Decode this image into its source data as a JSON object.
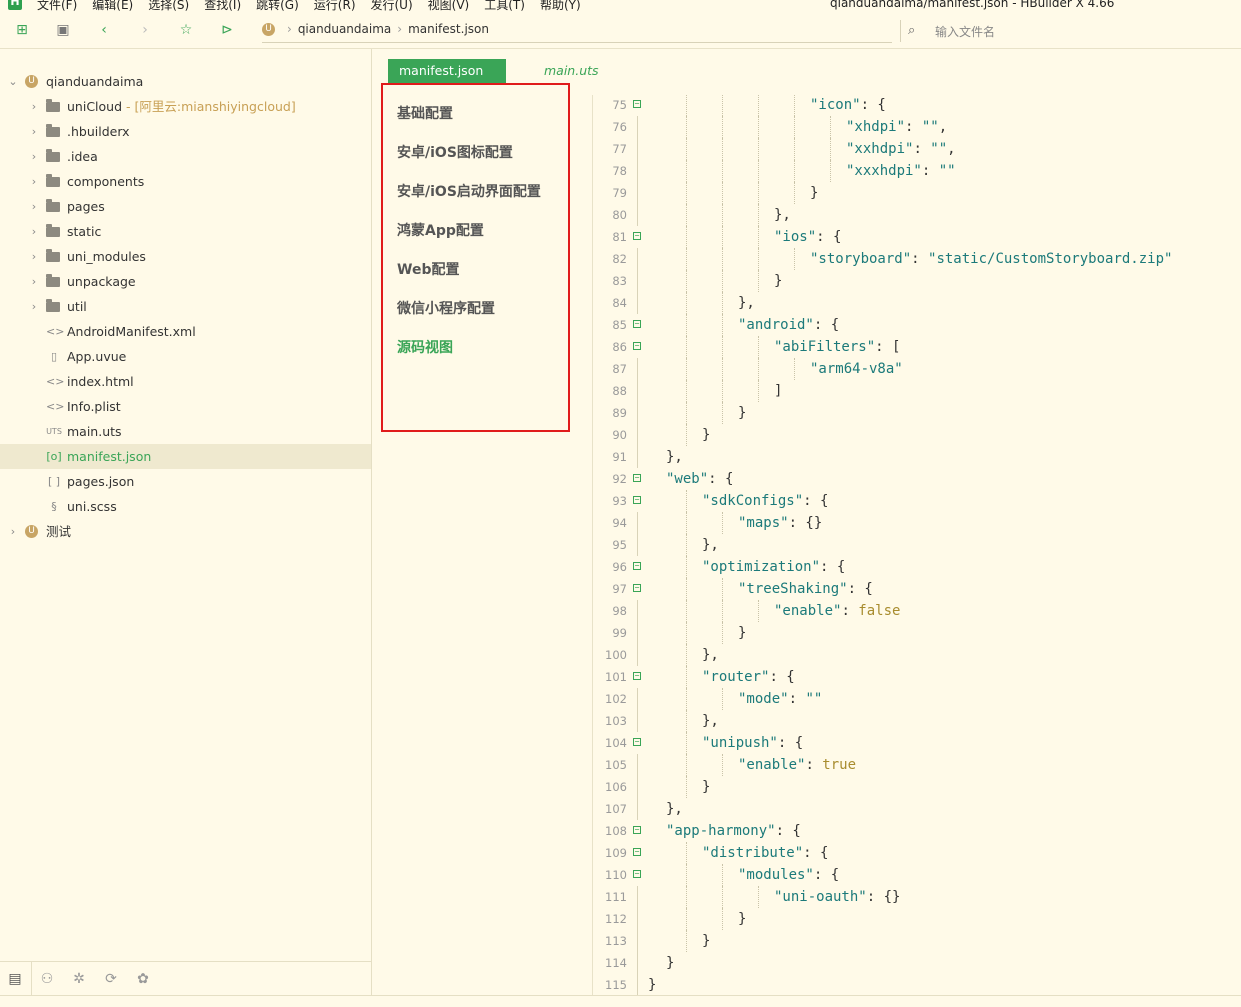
{
  "app": {
    "window_title": "qianduandaima/manifest.json - HBuilder X 4.66",
    "logo_letter": "H"
  },
  "menubar": {
    "items": [
      "文件(F)",
      "编辑(E)",
      "选择(S)",
      "查找(I)",
      "跳转(G)",
      "运行(R)",
      "发行(U)",
      "视图(V)",
      "工具(T)",
      "帮助(Y)"
    ]
  },
  "toolbar": {
    "icons": [
      "new-file-icon",
      "save-icon",
      "back-icon",
      "forward-icon",
      "star-icon",
      "run-icon"
    ],
    "breadcrumb": [
      "qianduandaima",
      "manifest.json"
    ],
    "search_placeholder": "输入文件名"
  },
  "sidebar": {
    "tree": [
      {
        "label": "qianduandaima",
        "type": "project",
        "expanded": true,
        "level": 0
      },
      {
        "label": "uniCloud",
        "annotation": "- [阿里云:mianshiyingcloud]",
        "type": "folder-cloud",
        "level": 1
      },
      {
        "label": ".hbuilderx",
        "type": "folder",
        "level": 1
      },
      {
        "label": ".idea",
        "type": "folder",
        "level": 1
      },
      {
        "label": "components",
        "type": "folder",
        "level": 1
      },
      {
        "label": "pages",
        "type": "folder",
        "level": 1
      },
      {
        "label": "static",
        "type": "folder",
        "level": 1
      },
      {
        "label": "uni_modules",
        "type": "folder",
        "level": 1
      },
      {
        "label": "unpackage",
        "type": "folder",
        "level": 1
      },
      {
        "label": "util",
        "type": "folder",
        "level": 1
      },
      {
        "label": "AndroidManifest.xml",
        "type": "xml",
        "glyph": "<>",
        "level": 1
      },
      {
        "label": "App.uvue",
        "type": "vue",
        "glyph": "▯",
        "level": 1
      },
      {
        "label": "index.html",
        "type": "html",
        "glyph": "<>",
        "level": 1
      },
      {
        "label": "Info.plist",
        "type": "plist",
        "glyph": "<>",
        "level": 1
      },
      {
        "label": "main.uts",
        "type": "uts",
        "glyph": "UTS",
        "level": 1
      },
      {
        "label": "manifest.json",
        "type": "json",
        "glyph": "[o]",
        "level": 1,
        "selected": true
      },
      {
        "label": "pages.json",
        "type": "json",
        "glyph": "[ ]",
        "level": 1
      },
      {
        "label": "uni.scss",
        "type": "scss",
        "glyph": "§",
        "level": 1
      },
      {
        "label": "测试",
        "type": "project",
        "expanded": false,
        "level": 0
      }
    ],
    "bottom_icons": [
      "project-manager-icon",
      "debug-icon",
      "bug-icon",
      "plugin-icon",
      "palette-icon"
    ]
  },
  "editor": {
    "tabs": [
      {
        "label": "manifest.json",
        "active": true
      },
      {
        "label": "main.uts",
        "active": false
      }
    ],
    "settings_nav": [
      {
        "label": "基础配置",
        "active": false
      },
      {
        "label": "安卓/iOS图标配置",
        "active": false
      },
      {
        "label": "安卓/iOS启动界面配置",
        "active": false
      },
      {
        "label": "鸿蒙App配置",
        "active": false
      },
      {
        "label": "Web配置",
        "active": false
      },
      {
        "label": "微信小程序配置",
        "active": false
      },
      {
        "label": "源码视图",
        "active": true
      }
    ],
    "code_lines": [
      {
        "n": 75,
        "fold": true,
        "indent": 5,
        "tokens": [
          [
            "k",
            "\"icon\""
          ],
          [
            "p",
            ": {"
          ]
        ]
      },
      {
        "n": 76,
        "indent": 6,
        "tokens": [
          [
            "k",
            "\"xhdpi\""
          ],
          [
            "p",
            ": "
          ],
          [
            "s",
            "\"\""
          ],
          [
            "p",
            ","
          ]
        ]
      },
      {
        "n": 77,
        "indent": 6,
        "tokens": [
          [
            "k",
            "\"xxhdpi\""
          ],
          [
            "p",
            ": "
          ],
          [
            "s",
            "\"\""
          ],
          [
            "p",
            ","
          ]
        ]
      },
      {
        "n": 78,
        "indent": 6,
        "tokens": [
          [
            "k",
            "\"xxxhdpi\""
          ],
          [
            "p",
            ": "
          ],
          [
            "s",
            "\"\""
          ]
        ]
      },
      {
        "n": 79,
        "indent": 5,
        "tokens": [
          [
            "p",
            "}"
          ]
        ]
      },
      {
        "n": 80,
        "indent": 4,
        "tokens": [
          [
            "p",
            "},"
          ]
        ]
      },
      {
        "n": 81,
        "fold": true,
        "indent": 4,
        "tokens": [
          [
            "k",
            "\"ios\""
          ],
          [
            "p",
            ": {"
          ]
        ]
      },
      {
        "n": 82,
        "indent": 5,
        "tokens": [
          [
            "k",
            "\"storyboard\""
          ],
          [
            "p",
            ": "
          ],
          [
            "s",
            "\"static/CustomStoryboard.zip\""
          ]
        ]
      },
      {
        "n": 83,
        "indent": 4,
        "tokens": [
          [
            "p",
            "}"
          ]
        ]
      },
      {
        "n": 84,
        "indent": 3,
        "tokens": [
          [
            "p",
            "},"
          ]
        ]
      },
      {
        "n": 85,
        "fold": true,
        "indent": 3,
        "tokens": [
          [
            "k",
            "\"android\""
          ],
          [
            "p",
            ": {"
          ]
        ]
      },
      {
        "n": 86,
        "fold": true,
        "indent": 4,
        "tokens": [
          [
            "k",
            "\"abiFilters\""
          ],
          [
            "p",
            ": ["
          ]
        ]
      },
      {
        "n": 87,
        "indent": 5,
        "tokens": [
          [
            "s",
            "\"arm64-v8a\""
          ]
        ]
      },
      {
        "n": 88,
        "indent": 4,
        "tokens": [
          [
            "p",
            "]"
          ]
        ]
      },
      {
        "n": 89,
        "indent": 3,
        "tokens": [
          [
            "p",
            "}"
          ]
        ]
      },
      {
        "n": 90,
        "indent": 2,
        "tokens": [
          [
            "p",
            "}"
          ]
        ]
      },
      {
        "n": 91,
        "indent": 1,
        "tokens": [
          [
            "p",
            "},"
          ]
        ]
      },
      {
        "n": 92,
        "fold": true,
        "indent": 1,
        "tokens": [
          [
            "k",
            "\"web\""
          ],
          [
            "p",
            ": {"
          ]
        ]
      },
      {
        "n": 93,
        "fold": true,
        "indent": 2,
        "tokens": [
          [
            "k",
            "\"sdkConfigs\""
          ],
          [
            "p",
            ": {"
          ]
        ]
      },
      {
        "n": 94,
        "indent": 3,
        "tokens": [
          [
            "k",
            "\"maps\""
          ],
          [
            "p",
            ": {}"
          ]
        ]
      },
      {
        "n": 95,
        "indent": 2,
        "tokens": [
          [
            "p",
            "},"
          ]
        ]
      },
      {
        "n": 96,
        "fold": true,
        "indent": 2,
        "tokens": [
          [
            "k",
            "\"optimization\""
          ],
          [
            "p",
            ": {"
          ]
        ]
      },
      {
        "n": 97,
        "fold": true,
        "indent": 3,
        "tokens": [
          [
            "k",
            "\"treeShaking\""
          ],
          [
            "p",
            ": {"
          ]
        ]
      },
      {
        "n": 98,
        "indent": 4,
        "tokens": [
          [
            "k",
            "\"enable\""
          ],
          [
            "p",
            ": "
          ],
          [
            "b",
            "false"
          ]
        ]
      },
      {
        "n": 99,
        "indent": 3,
        "tokens": [
          [
            "p",
            "}"
          ]
        ]
      },
      {
        "n": 100,
        "indent": 2,
        "tokens": [
          [
            "p",
            "},"
          ]
        ]
      },
      {
        "n": 101,
        "fold": true,
        "indent": 2,
        "tokens": [
          [
            "k",
            "\"router\""
          ],
          [
            "p",
            ": {"
          ]
        ]
      },
      {
        "n": 102,
        "indent": 3,
        "tokens": [
          [
            "k",
            "\"mode\""
          ],
          [
            "p",
            ": "
          ],
          [
            "s",
            "\"\""
          ]
        ]
      },
      {
        "n": 103,
        "indent": 2,
        "tokens": [
          [
            "p",
            "},"
          ]
        ]
      },
      {
        "n": 104,
        "fold": true,
        "indent": 2,
        "tokens": [
          [
            "k",
            "\"unipush\""
          ],
          [
            "p",
            ": {"
          ]
        ]
      },
      {
        "n": 105,
        "indent": 3,
        "tokens": [
          [
            "k",
            "\"enable\""
          ],
          [
            "p",
            ": "
          ],
          [
            "b",
            "true"
          ]
        ]
      },
      {
        "n": 106,
        "indent": 2,
        "tokens": [
          [
            "p",
            "}"
          ]
        ]
      },
      {
        "n": 107,
        "indent": 1,
        "tokens": [
          [
            "p",
            "},"
          ]
        ]
      },
      {
        "n": 108,
        "fold": true,
        "indent": 1,
        "tokens": [
          [
            "k",
            "\"app-harmony\""
          ],
          [
            "p",
            ": {"
          ]
        ]
      },
      {
        "n": 109,
        "fold": true,
        "indent": 2,
        "tokens": [
          [
            "k",
            "\"distribute\""
          ],
          [
            "p",
            ": {"
          ]
        ]
      },
      {
        "n": 110,
        "fold": true,
        "indent": 3,
        "tokens": [
          [
            "k",
            "\"modules\""
          ],
          [
            "p",
            ": {"
          ]
        ]
      },
      {
        "n": 111,
        "indent": 4,
        "tokens": [
          [
            "k",
            "\"uni-oauth\""
          ],
          [
            "p",
            ": {}"
          ]
        ]
      },
      {
        "n": 112,
        "indent": 3,
        "tokens": [
          [
            "p",
            "}"
          ]
        ]
      },
      {
        "n": 113,
        "indent": 2,
        "tokens": [
          [
            "p",
            "}"
          ]
        ]
      },
      {
        "n": 114,
        "indent": 1,
        "tokens": [
          [
            "p",
            "}"
          ]
        ]
      },
      {
        "n": 115,
        "indent": 0,
        "tokens": [
          [
            "p",
            "}"
          ]
        ]
      }
    ]
  },
  "colors": {
    "accent": "#3aa557",
    "background": "#fffae8",
    "highlight_border": "#e01b1b",
    "json_key": "#1c7a7a",
    "json_bool": "#a88c2e"
  }
}
